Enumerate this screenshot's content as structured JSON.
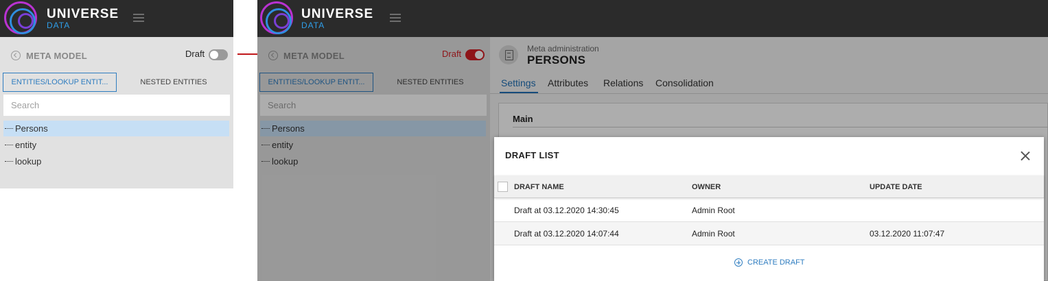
{
  "brand": {
    "name": "UNIVERSE",
    "sub": "DATA"
  },
  "sidebar": {
    "title": "META MODEL",
    "draft_label": "Draft",
    "tabs": [
      {
        "label": "ENTITIES/LOOKUP ENTIT...",
        "active": true
      },
      {
        "label": "NESTED ENTITIES",
        "active": false
      }
    ],
    "search_placeholder": "Search",
    "items": [
      {
        "label": "Persons",
        "selected": true
      },
      {
        "label": "entity",
        "selected": false
      },
      {
        "label": "lookup",
        "selected": false
      }
    ]
  },
  "left_state": {
    "draft_on": false
  },
  "right_state": {
    "draft_on": true
  },
  "main": {
    "breadcrumb": "Meta administration",
    "title": "PERSONS",
    "tabs": [
      {
        "label": "Settings",
        "active": true
      },
      {
        "label": "Attributes",
        "active": false
      },
      {
        "label": "Relations",
        "active": false
      },
      {
        "label": "Consolidation",
        "active": false
      }
    ],
    "section_title": "Main"
  },
  "dialog": {
    "title": "DRAFT LIST",
    "columns": [
      "DRAFT NAME",
      "OWNER",
      "UPDATE DATE"
    ],
    "rows": [
      {
        "name": "Draft at 03.12.2020 14:30:45",
        "owner": "Admin Root",
        "update": ""
      },
      {
        "name": "Draft at 03.12.2020 14:07:44",
        "owner": "Admin Root",
        "update": "03.12.2020 11:07:47"
      }
    ],
    "create_label": "CREATE DRAFT"
  },
  "colors": {
    "accent": "#2f7dc0",
    "draft_on": "#d11f25",
    "arrow": "#c0171b",
    "topbar": "#2b2b2b"
  }
}
